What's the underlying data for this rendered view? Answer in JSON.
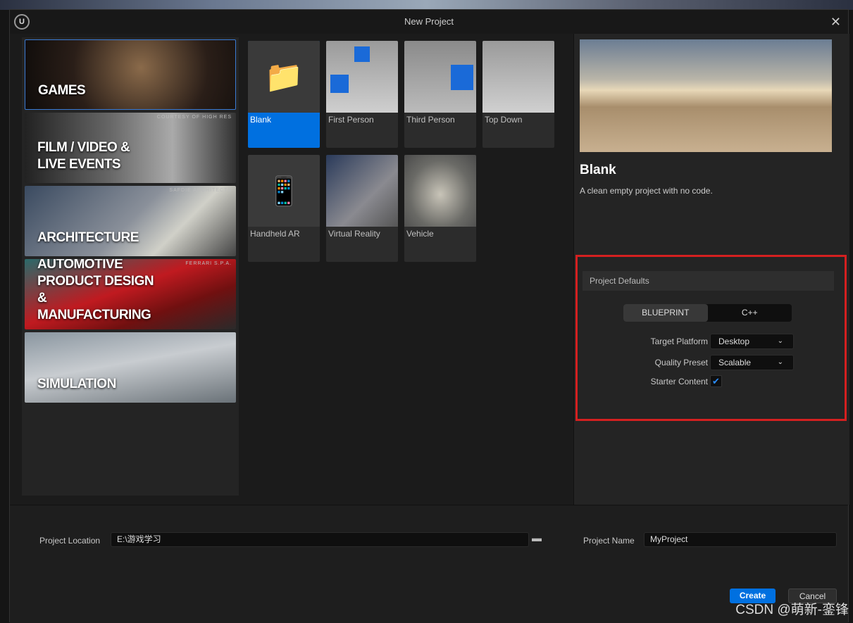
{
  "window": {
    "title": "New Project"
  },
  "categories": [
    {
      "label": "GAMES",
      "credit": ""
    },
    {
      "label": "FILM / VIDEO & LIVE EVENTS",
      "credit": "COURTESY OF HIGH RES"
    },
    {
      "label": "ARCHITECTURE",
      "credit": "SAFDIE ARCHITECTS"
    },
    {
      "label": "AUTOMOTIVE PRODUCT DESIGN & MANUFACTURING",
      "credit": "FERRARI S.P.A."
    },
    {
      "label": "SIMULATION",
      "credit": ""
    }
  ],
  "templates": [
    {
      "label": "Blank",
      "selected": true
    },
    {
      "label": "First Person"
    },
    {
      "label": "Third Person"
    },
    {
      "label": "Top Down"
    },
    {
      "label": "Handheld AR"
    },
    {
      "label": "Virtual Reality"
    },
    {
      "label": "Vehicle"
    }
  ],
  "details": {
    "title": "Blank",
    "description": "A clean empty project with no code."
  },
  "defaults": {
    "header": "Project Defaults",
    "blueprint": "BLUEPRINT",
    "cpp": "C++",
    "selected": "BLUEPRINT",
    "target_platform_label": "Target Platform",
    "target_platform": "Desktop",
    "quality_preset_label": "Quality Preset",
    "quality_preset": "Scalable",
    "starter_content_label": "Starter Content",
    "starter_content": true
  },
  "bottom": {
    "location_label": "Project Location",
    "location": "E:\\游戏学习",
    "name_label": "Project Name",
    "name": "MyProject",
    "create": "Create",
    "cancel": "Cancel"
  },
  "watermark": "CSDN @萌新-銮锋",
  "colors": {
    "accent": "#0070e0",
    "highlight_box": "#d42020"
  }
}
